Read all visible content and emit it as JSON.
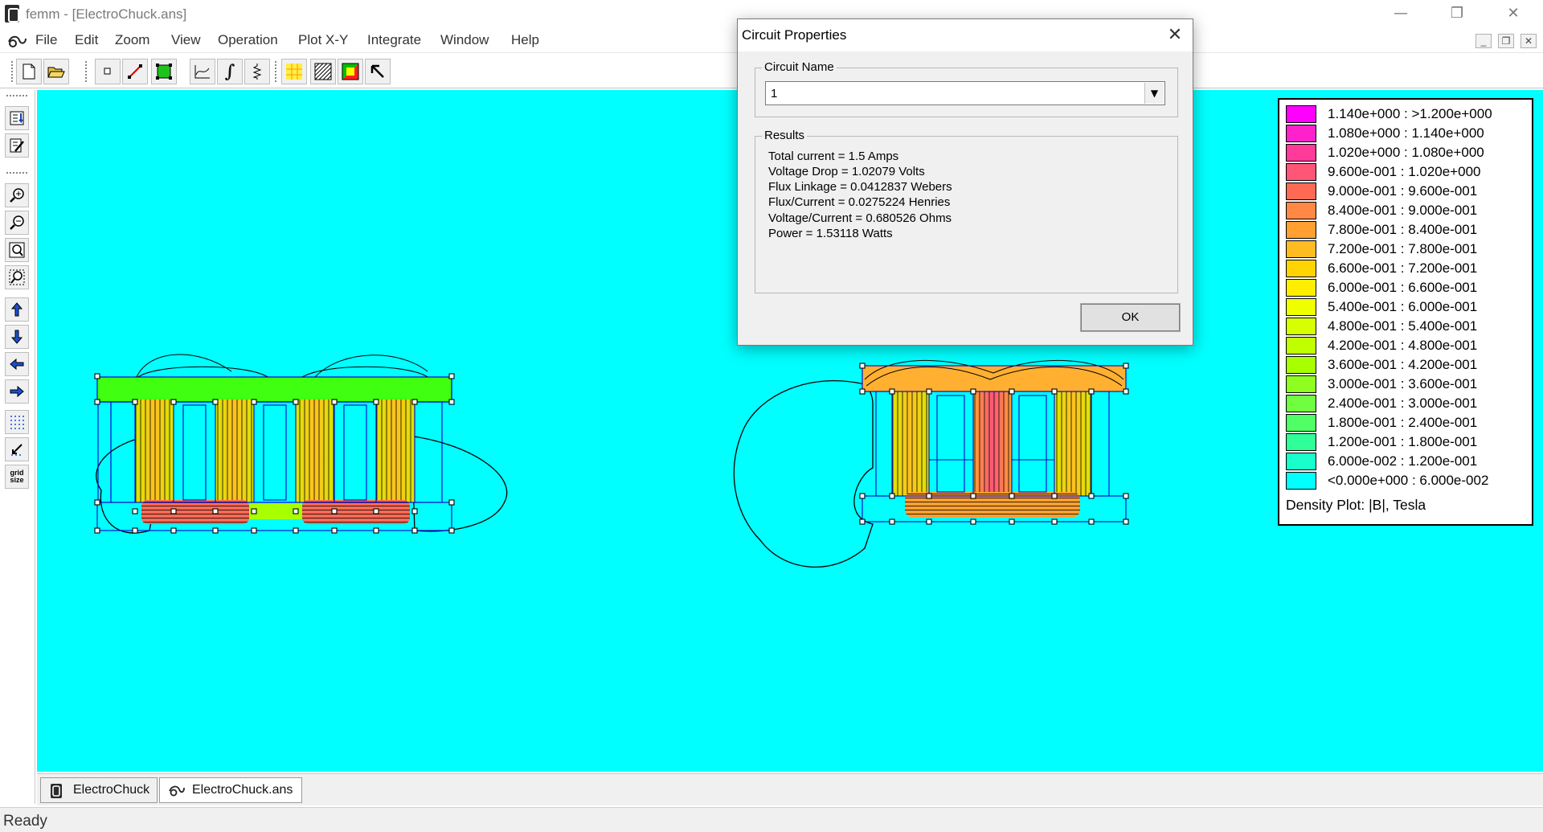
{
  "window": {
    "title": "femm - [ElectroChuck.ans]",
    "controls": {
      "minimize": "—",
      "restore": "❐",
      "close": "✕"
    }
  },
  "menu": {
    "items": [
      "File",
      "Edit",
      "Zoom",
      "View",
      "Operation",
      "Plot X-Y",
      "Integrate",
      "Window",
      "Help"
    ],
    "mdi_controls": {
      "minimize": "_",
      "restore": "❐",
      "close": "✕"
    }
  },
  "toolbar": {
    "icons": [
      "new-file-icon",
      "open-file-icon",
      "point-mode-icon",
      "line-mode-icon",
      "block-mode-icon",
      "plot-xy-icon",
      "integrate-icon",
      "circuit-props-icon",
      "contour-plot-icon",
      "vector-plot-icon",
      "density-plot-icon",
      "select-arrow-icon"
    ]
  },
  "left_toolbar": {
    "icons": [
      "show-mesh-icon",
      "edit-props-icon",
      "zoom-in-icon",
      "zoom-out-icon",
      "zoom-natural-icon",
      "zoom-window-icon",
      "pan-up-icon",
      "pan-down-icon",
      "pan-left-icon",
      "pan-right-icon",
      "show-grid-icon",
      "snap-grid-icon",
      "grid-size-icon"
    ],
    "grid_size_label": "grid size"
  },
  "legend": {
    "colors": [
      "#ff00ff",
      "#ff22cc",
      "#ff3a99",
      "#ff5577",
      "#ff6a55",
      "#ff8844",
      "#ffa030",
      "#ffbb22",
      "#ffd400",
      "#ffee00",
      "#f0ff00",
      "#d8ff00",
      "#c0ff00",
      "#a8ff00",
      "#90ff20",
      "#70ff40",
      "#50ff66",
      "#30ff99",
      "#18ffcc",
      "#00ffff"
    ],
    "ranges": [
      "1.140e+000 : >1.200e+000",
      "1.080e+000 : 1.140e+000",
      "1.020e+000 : 1.080e+000",
      "9.600e-001 : 1.020e+000",
      "9.000e-001 : 9.600e-001",
      "8.400e-001 : 9.000e-001",
      "7.800e-001 : 8.400e-001",
      "7.200e-001 : 7.800e-001",
      "6.600e-001 : 7.200e-001",
      "6.000e-001 : 6.600e-001",
      "5.400e-001 : 6.000e-001",
      "4.800e-001 : 5.400e-001",
      "4.200e-001 : 4.800e-001",
      "3.600e-001 : 4.200e-001",
      "3.000e-001 : 3.600e-001",
      "2.400e-001 : 3.000e-001",
      "1.800e-001 : 2.400e-001",
      "1.200e-001 : 1.800e-001",
      "6.000e-002 : 1.200e-001",
      "<0.000e+000 : 6.000e-002"
    ],
    "caption": "Density Plot: |B|, Tesla"
  },
  "dialog": {
    "title": "Circuit Properties",
    "close_glyph": "✕",
    "circuit_name_label": "Circuit Name",
    "circuit_name_value": "1",
    "dropdown_arrow": "▼",
    "results_label": "Results",
    "results": [
      "Total current = 1.5 Amps",
      "Voltage Drop = 1.02079 Volts",
      "Flux Linkage = 0.0412837 Webers",
      "Flux/Current = 0.0275224 Henries",
      "Voltage/Current = 0.680526 Ohms",
      "Power = 1.53118 Watts"
    ],
    "ok_label": "OK"
  },
  "tabs": [
    {
      "label": "ElectroChuck",
      "icon": "femm-doc-icon"
    },
    {
      "label": "ElectroChuck.ans",
      "icon": "postprocessor-icon"
    }
  ],
  "status": {
    "text": "Ready"
  },
  "colors": {
    "canvas": "#00ffff",
    "outline": "#0000cc",
    "contour": "#000000"
  }
}
